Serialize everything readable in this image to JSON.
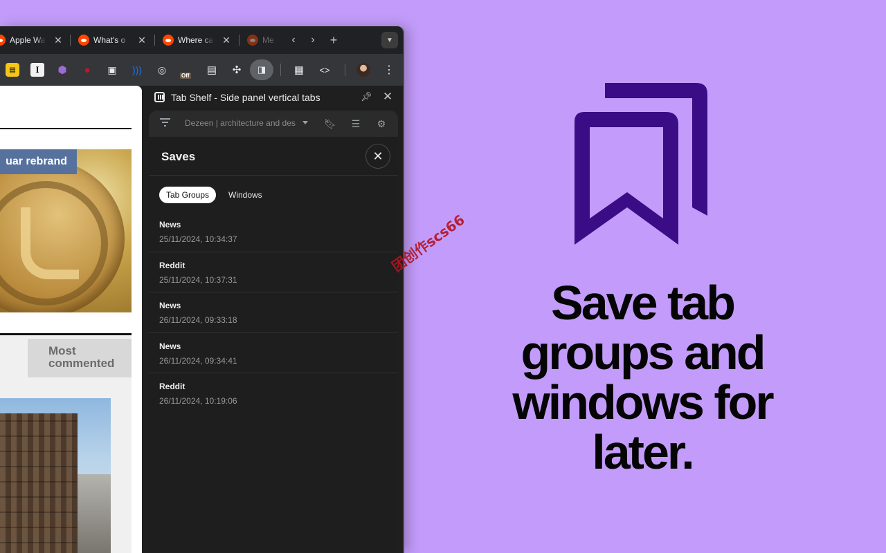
{
  "tabs": [
    {
      "title": "Apple Wa"
    },
    {
      "title": "What's o"
    },
    {
      "title": "Where ca"
    },
    {
      "title": "Me"
    }
  ],
  "toolbar": {
    "off_badge": "Off",
    "reader_letter": "I"
  },
  "webpage": {
    "badge": "uar rebrand",
    "most_commented": "Most commented"
  },
  "side_panel": {
    "title": "Tab Shelf - Side panel vertical tabs"
  },
  "app_toolbar": {
    "dropdown_value": "Dezeen | architecture and design"
  },
  "saves": {
    "title": "Saves",
    "segments": [
      "Tab Groups",
      "Windows"
    ],
    "items": [
      {
        "name": "News",
        "date": "25/11/2024, 10:34:37"
      },
      {
        "name": "Reddit",
        "date": "25/11/2024, 10:37:31"
      },
      {
        "name": "News",
        "date": "26/11/2024, 09:33:18"
      },
      {
        "name": "News",
        "date": "26/11/2024, 09:34:41"
      },
      {
        "name": "Reddit",
        "date": "26/11/2024, 10:19:06"
      }
    ]
  },
  "watermark": "团创作scs66",
  "promo": {
    "headline_lines": [
      "Save tab",
      "groups and",
      "windows for",
      "later."
    ],
    "accent_color": "#3a0d86",
    "background_color": "#c39cfb"
  }
}
